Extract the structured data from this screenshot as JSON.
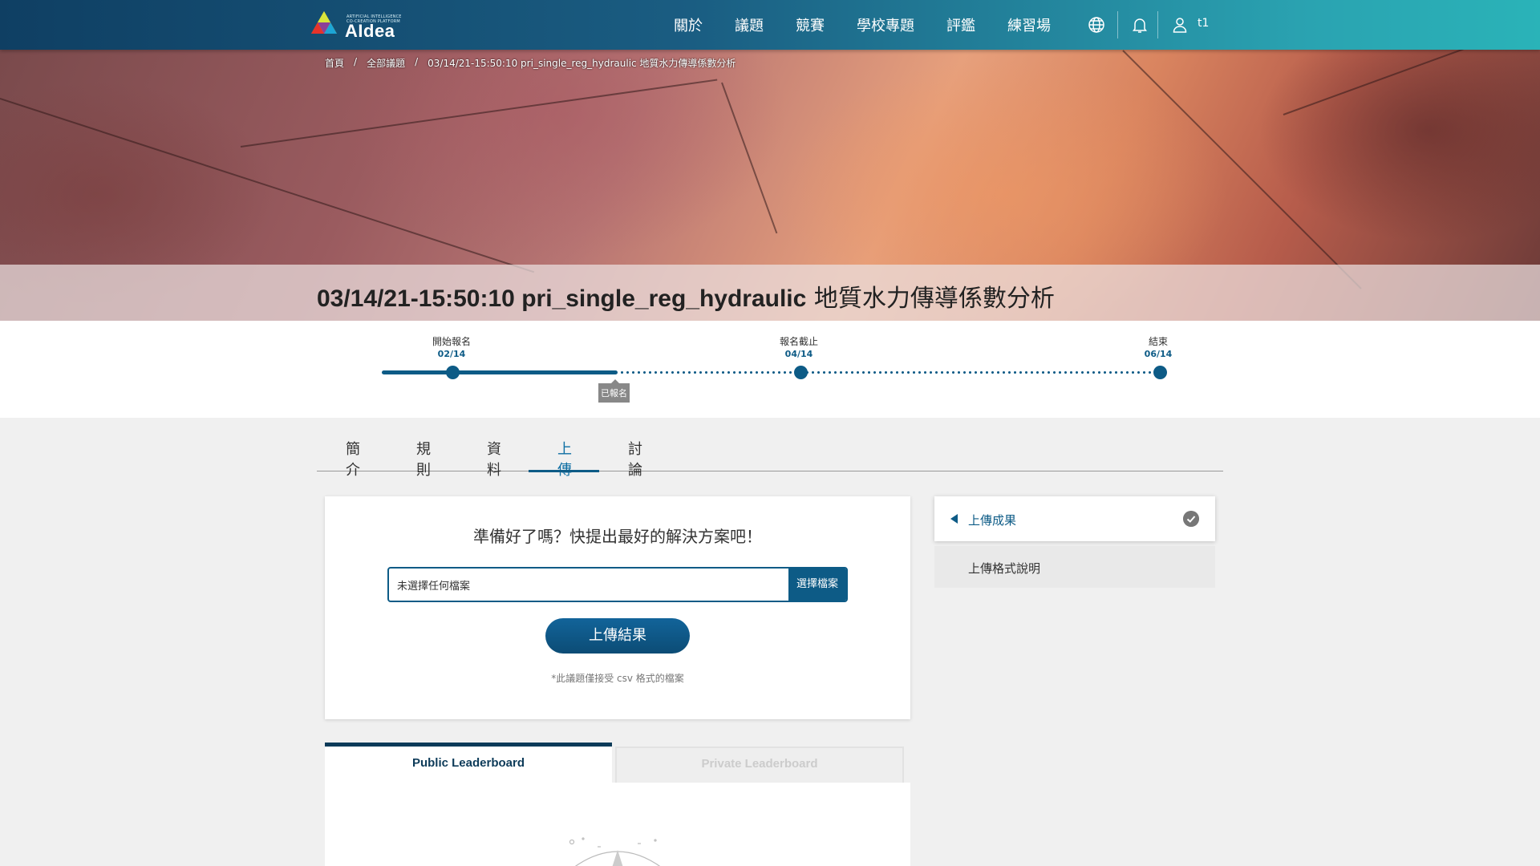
{
  "brand": {
    "name": "AIdea",
    "tagline": "ARTIFICIAL INTELLIGENCE CO-CREATION PLATFORM"
  },
  "nav": {
    "items": [
      "關於",
      "議題",
      "競賽",
      "學校專題",
      "評鑑",
      "練習場"
    ]
  },
  "user": {
    "name": "t1"
  },
  "breadcrumb": {
    "home": "首頁",
    "sep1": "/",
    "all": "全部議題",
    "sep2": "/",
    "current": "03/14/21-15:50:10 pri_single_reg_hydraulic 地質水力傳導係數分析"
  },
  "page": {
    "title_en": "03/14/21-15:50:10 pri_single_reg_hydraulic",
    "title_zh": " 地質水力傳導係數分析"
  },
  "timeline": {
    "start_label": "開始報名",
    "start_date": "02/14",
    "deadline_label": "報名截止",
    "deadline_date": "04/14",
    "end_label": "結束",
    "end_date": "06/14",
    "status_badge": "已報名"
  },
  "tabs": [
    "簡介",
    "規則",
    "資料",
    "上傳",
    "討論"
  ],
  "upload": {
    "heading": "準備好了嗎？快提出最好的解決方案吧！",
    "file_placeholder": "未選擇任何檔案",
    "choose_button": "選擇檔案",
    "submit_button": "上傳結果",
    "hint": "*此議題僅接受 csv 格式的檔案"
  },
  "side_menu": {
    "active": "上傳成果",
    "item": "上傳格式說明"
  },
  "leaderboard": {
    "public_tab": "Public Leaderboard",
    "private_tab": "Private Leaderboard"
  },
  "colors": {
    "primary": "#0d5b86",
    "accent": "#2ab3b8"
  }
}
